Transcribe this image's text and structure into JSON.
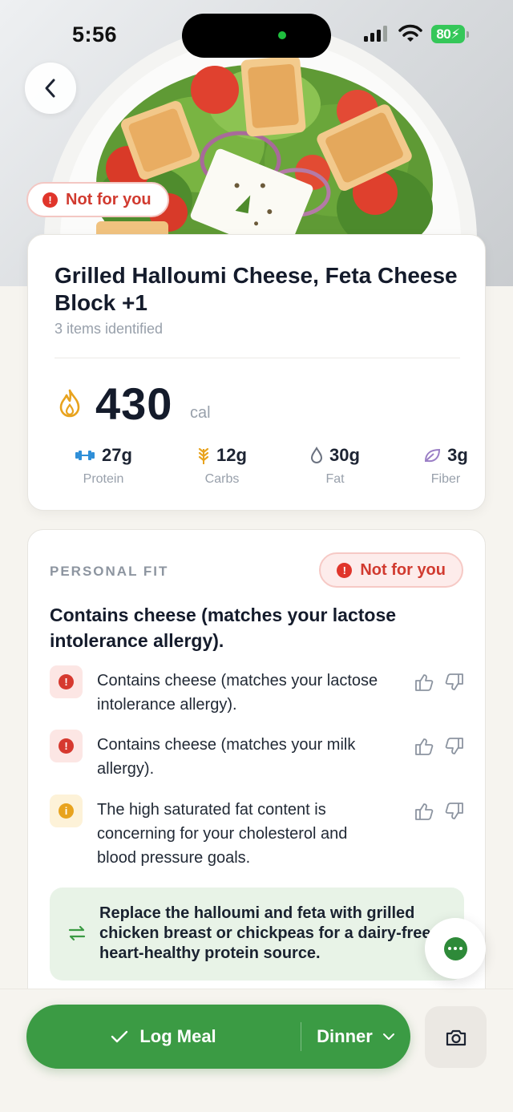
{
  "status_bar": {
    "time": "5:56",
    "battery": "80"
  },
  "hero": {
    "verdict_badge": "Not for you"
  },
  "meal": {
    "title": "Grilled Halloumi Cheese, Feta Cheese Block +1",
    "items_identified": "3 items identified",
    "calories": "430",
    "calories_unit": "cal",
    "macros": [
      {
        "value": "27g",
        "label": "Protein",
        "icon": "dumbbell-icon",
        "color": "#2f8fd8"
      },
      {
        "value": "12g",
        "label": "Carbs",
        "icon": "wheat-icon",
        "color": "#e8a31e"
      },
      {
        "value": "30g",
        "label": "Fat",
        "icon": "drop-icon",
        "color": "#6b7280"
      },
      {
        "value": "3g",
        "label": "Fiber",
        "icon": "leaf-icon",
        "color": "#9b7fc6"
      }
    ]
  },
  "personal_fit": {
    "heading": "PERSONAL FIT",
    "verdict_badge": "Not for you",
    "summary": "Contains cheese (matches your lactose intolerance allergy).",
    "reasons": [
      {
        "severity": "red",
        "text": "Contains cheese (matches your lactose intolerance allergy)."
      },
      {
        "severity": "red",
        "text": "Contains cheese (matches your milk allergy)."
      },
      {
        "severity": "amber",
        "text": "The high saturated fat content is concerning for your cholesterol and blood pressure goals."
      }
    ],
    "swap_tip": "Replace the halloumi and feta with grilled chicken breast or chickpeas for a dairy-free, heart-healthy protein source."
  },
  "actions": {
    "log_label": "Log Meal",
    "meal_type": "Dinner"
  },
  "colors": {
    "accent_green": "#3b9b44",
    "alert_red": "#d13a2f",
    "warning_amber": "#e8a31e"
  }
}
